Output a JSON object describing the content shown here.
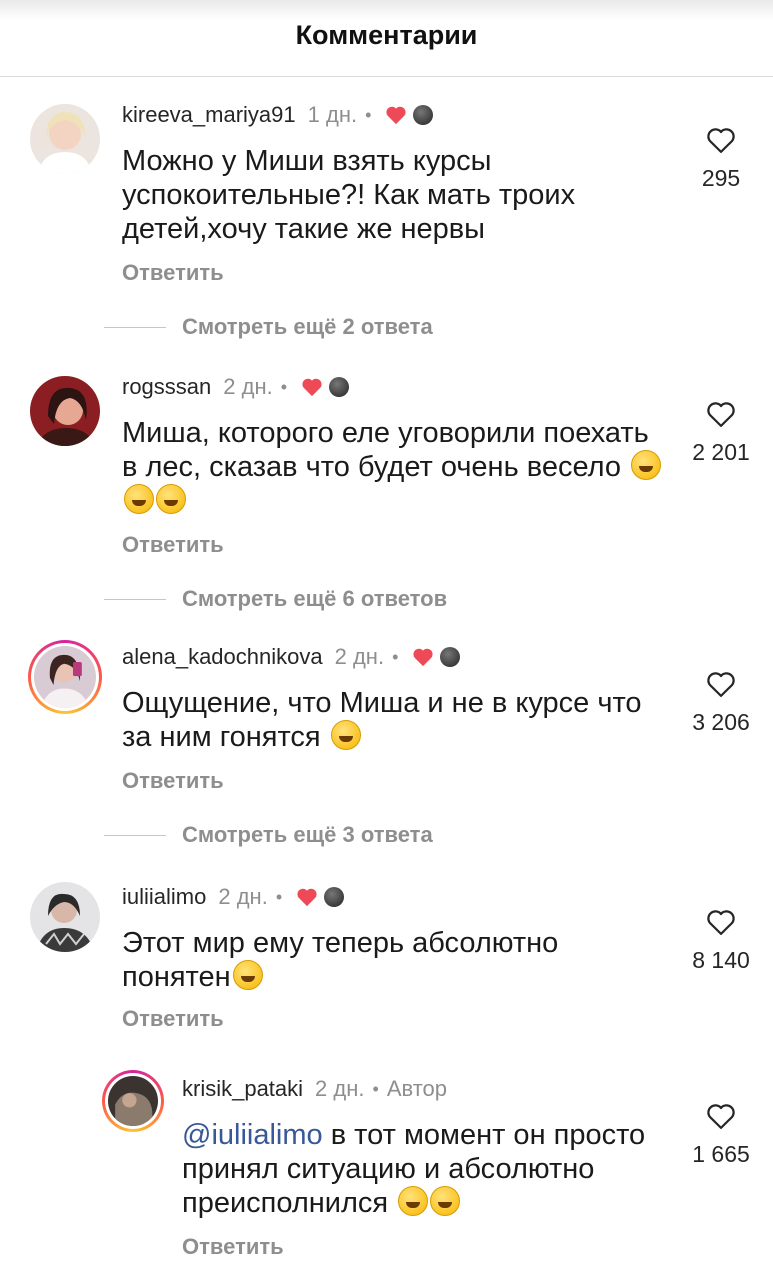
{
  "header": {
    "title": "Комментарии"
  },
  "comments": [
    {
      "username": "kireeva_mariya91",
      "time": "1 дн.",
      "text": "Можно у Миши взять курсы успокоительные?! Как мать троих детей,хочу такие же нервы",
      "reply_label": "Ответить",
      "likes": "295",
      "view_more": "Смотреть ещё 2 ответа"
    },
    {
      "username": "rogsssan",
      "time": "2 дн.",
      "text": "Миша, которого еле уговорили поехать в лес, сказав что будет очень весело",
      "reply_label": "Ответить",
      "likes": "2 201",
      "view_more": "Смотреть ещё 6 ответов"
    },
    {
      "username": "alena_kadochnikova",
      "time": "2 дн.",
      "text": "Ощущение, что Миша и не в курсе что за ним гонятся",
      "reply_label": "Ответить",
      "likes": "3 206",
      "view_more": "Смотреть ещё 3 ответа"
    },
    {
      "username": "iuliialimo",
      "time": "2 дн.",
      "text": "Этот мир ему теперь абсолютно понятен",
      "reply_label": "Ответить",
      "likes": "8 140"
    }
  ],
  "reply": {
    "username": "krisik_pataki",
    "time": "2 дн.",
    "badge": "Автор",
    "mention": "@iuliialimo",
    "text": " в тот момент он просто принял ситуацию и абсолютно преисполнился",
    "reply_label": "Ответить",
    "likes": "1 665"
  },
  "separator": "•",
  "icons": {
    "like": "heart-outline-icon",
    "liked_by_author": "heart-filled-icon",
    "emoji": "emoji-icon"
  },
  "colors": {
    "heart": "#ed4956",
    "mention": "#385898",
    "muted": "#8e8e8e"
  }
}
